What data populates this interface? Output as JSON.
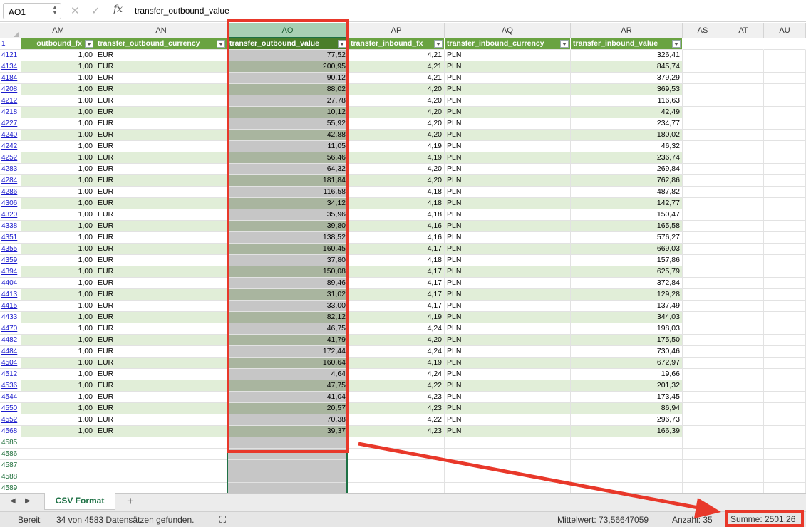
{
  "formula_bar": {
    "name_box": "AO1",
    "cancel_icon": "close-icon",
    "enter_icon": "check-icon",
    "fx_label": "fx",
    "formula": "transfer_outbound_value"
  },
  "columns": [
    "AM",
    "AN",
    "AO",
    "AP",
    "AQ",
    "AR",
    "AS",
    "AT",
    "AU"
  ],
  "header_row": {
    "row_number": "1",
    "am": "outbound_fx",
    "an": "transfer_outbound_currency",
    "ao": "transfer_outbound_value",
    "ap": "transfer_inbound_fx",
    "aq": "transfer_inbound_currency",
    "ar": "transfer_inbound_value"
  },
  "rows": [
    {
      "n": "4121",
      "am": "1,00",
      "an": "EUR",
      "ao": "77,52",
      "ap": "4,21",
      "aq": "PLN",
      "ar": "326,41"
    },
    {
      "n": "4134",
      "am": "1,00",
      "an": "EUR",
      "ao": "200,95",
      "ap": "4,21",
      "aq": "PLN",
      "ar": "845,74"
    },
    {
      "n": "4184",
      "am": "1,00",
      "an": "EUR",
      "ao": "90,12",
      "ap": "4,21",
      "aq": "PLN",
      "ar": "379,29"
    },
    {
      "n": "4208",
      "am": "1,00",
      "an": "EUR",
      "ao": "88,02",
      "ap": "4,20",
      "aq": "PLN",
      "ar": "369,53"
    },
    {
      "n": "4212",
      "am": "1,00",
      "an": "EUR",
      "ao": "27,78",
      "ap": "4,20",
      "aq": "PLN",
      "ar": "116,63"
    },
    {
      "n": "4218",
      "am": "1,00",
      "an": "EUR",
      "ao": "10,12",
      "ap": "4,20",
      "aq": "PLN",
      "ar": "42,49"
    },
    {
      "n": "4227",
      "am": "1,00",
      "an": "EUR",
      "ao": "55,92",
      "ap": "4,20",
      "aq": "PLN",
      "ar": "234,77"
    },
    {
      "n": "4240",
      "am": "1,00",
      "an": "EUR",
      "ao": "42,88",
      "ap": "4,20",
      "aq": "PLN",
      "ar": "180,02"
    },
    {
      "n": "4242",
      "am": "1,00",
      "an": "EUR",
      "ao": "11,05",
      "ap": "4,19",
      "aq": "PLN",
      "ar": "46,32"
    },
    {
      "n": "4252",
      "am": "1,00",
      "an": "EUR",
      "ao": "56,46",
      "ap": "4,19",
      "aq": "PLN",
      "ar": "236,74"
    },
    {
      "n": "4283",
      "am": "1,00",
      "an": "EUR",
      "ao": "64,32",
      "ap": "4,20",
      "aq": "PLN",
      "ar": "269,84"
    },
    {
      "n": "4284",
      "am": "1,00",
      "an": "EUR",
      "ao": "181,84",
      "ap": "4,20",
      "aq": "PLN",
      "ar": "762,86"
    },
    {
      "n": "4286",
      "am": "1,00",
      "an": "EUR",
      "ao": "116,58",
      "ap": "4,18",
      "aq": "PLN",
      "ar": "487,82"
    },
    {
      "n": "4306",
      "am": "1,00",
      "an": "EUR",
      "ao": "34,12",
      "ap": "4,18",
      "aq": "PLN",
      "ar": "142,77"
    },
    {
      "n": "4320",
      "am": "1,00",
      "an": "EUR",
      "ao": "35,96",
      "ap": "4,18",
      "aq": "PLN",
      "ar": "150,47"
    },
    {
      "n": "4338",
      "am": "1,00",
      "an": "EUR",
      "ao": "39,80",
      "ap": "4,16",
      "aq": "PLN",
      "ar": "165,58"
    },
    {
      "n": "4351",
      "am": "1,00",
      "an": "EUR",
      "ao": "138,52",
      "ap": "4,16",
      "aq": "PLN",
      "ar": "576,27"
    },
    {
      "n": "4355",
      "am": "1,00",
      "an": "EUR",
      "ao": "160,45",
      "ap": "4,17",
      "aq": "PLN",
      "ar": "669,03"
    },
    {
      "n": "4359",
      "am": "1,00",
      "an": "EUR",
      "ao": "37,80",
      "ap": "4,18",
      "aq": "PLN",
      "ar": "157,86"
    },
    {
      "n": "4394",
      "am": "1,00",
      "an": "EUR",
      "ao": "150,08",
      "ap": "4,17",
      "aq": "PLN",
      "ar": "625,79"
    },
    {
      "n": "4404",
      "am": "1,00",
      "an": "EUR",
      "ao": "89,46",
      "ap": "4,17",
      "aq": "PLN",
      "ar": "372,84"
    },
    {
      "n": "4413",
      "am": "1,00",
      "an": "EUR",
      "ao": "31,02",
      "ap": "4,17",
      "aq": "PLN",
      "ar": "129,28"
    },
    {
      "n": "4415",
      "am": "1,00",
      "an": "EUR",
      "ao": "33,00",
      "ap": "4,17",
      "aq": "PLN",
      "ar": "137,49"
    },
    {
      "n": "4433",
      "am": "1,00",
      "an": "EUR",
      "ao": "82,12",
      "ap": "4,19",
      "aq": "PLN",
      "ar": "344,03"
    },
    {
      "n": "4470",
      "am": "1,00",
      "an": "EUR",
      "ao": "46,75",
      "ap": "4,24",
      "aq": "PLN",
      "ar": "198,03"
    },
    {
      "n": "4482",
      "am": "1,00",
      "an": "EUR",
      "ao": "41,79",
      "ap": "4,20",
      "aq": "PLN",
      "ar": "175,50"
    },
    {
      "n": "4484",
      "am": "1,00",
      "an": "EUR",
      "ao": "172,44",
      "ap": "4,24",
      "aq": "PLN",
      "ar": "730,46"
    },
    {
      "n": "4504",
      "am": "1,00",
      "an": "EUR",
      "ao": "160,64",
      "ap": "4,19",
      "aq": "PLN",
      "ar": "672,97"
    },
    {
      "n": "4512",
      "am": "1,00",
      "an": "EUR",
      "ao": "4,64",
      "ap": "4,24",
      "aq": "PLN",
      "ar": "19,66"
    },
    {
      "n": "4536",
      "am": "1,00",
      "an": "EUR",
      "ao": "47,75",
      "ap": "4,22",
      "aq": "PLN",
      "ar": "201,32"
    },
    {
      "n": "4544",
      "am": "1,00",
      "an": "EUR",
      "ao": "41,04",
      "ap": "4,23",
      "aq": "PLN",
      "ar": "173,45"
    },
    {
      "n": "4550",
      "am": "1,00",
      "an": "EUR",
      "ao": "20,57",
      "ap": "4,23",
      "aq": "PLN",
      "ar": "86,94"
    },
    {
      "n": "4552",
      "am": "1,00",
      "an": "EUR",
      "ao": "70,38",
      "ap": "4,22",
      "aq": "PLN",
      "ar": "296,73"
    },
    {
      "n": "4568",
      "am": "1,00",
      "an": "EUR",
      "ao": "39,37",
      "ap": "4,23",
      "aq": "PLN",
      "ar": "166,39"
    }
  ],
  "empty_rows": [
    "4585",
    "4586",
    "4587",
    "4588",
    "4589"
  ],
  "tabs": {
    "prev_icon": "chevron-left-icon",
    "next_icon": "chevron-right-icon",
    "sheet_name": "CSV Format",
    "add_icon": "plus-icon"
  },
  "status": {
    "mode": "Bereit",
    "filter_info": "34 von 4583 Datensätzen gefunden.",
    "accessibility_icon": "accessibility-icon",
    "average": "Mittelwert: 73,56647059",
    "count": "Anzahl: 35",
    "sum": "Summe: 2501,26"
  },
  "colors": {
    "header_green": "#6aa342",
    "band_green": "#e1eed8",
    "selection_gray": "#c6c6c6",
    "annotation_red": "#e8382a",
    "excel_green": "#1e7145"
  }
}
